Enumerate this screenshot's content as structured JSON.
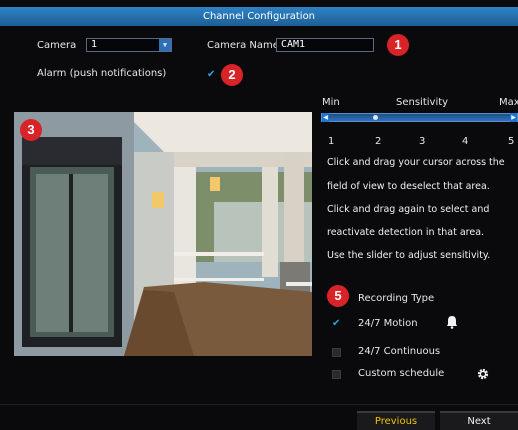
{
  "window": {
    "title": "Channel Configuration"
  },
  "camera": {
    "label": "Camera",
    "value": "1"
  },
  "camera_name": {
    "label": "Camera Name",
    "value": "CAM1"
  },
  "alarm": {
    "label": "Alarm (push notifications)",
    "checked": true
  },
  "callouts": [
    "1",
    "2",
    "3",
    "5"
  ],
  "sensitivity": {
    "min_label": "Min",
    "title": "Sensitivity",
    "max_label": "Max",
    "ticks": [
      "1",
      "2",
      "3",
      "4",
      "5"
    ],
    "level": 2
  },
  "instructions": [
    "Click and drag your cursor across the",
    "field of view to deselect that area.",
    "Click and drag again to select and",
    "reactivate detection in that area.",
    "Use the slider to adjust sensitivity."
  ],
  "recording": {
    "title": "Recording Type",
    "options": [
      {
        "label": "24/7 Motion",
        "checked": true,
        "icon": "bell-icon"
      },
      {
        "label": "24/7 Continuous",
        "checked": false
      },
      {
        "label": "Custom schedule",
        "checked": false,
        "icon": "gear-icon"
      }
    ]
  },
  "footer": {
    "previous_label": "Previous",
    "next_label": "Next"
  },
  "colors": {
    "accent": "#2d83c6",
    "callout": "#d82428",
    "previous_text": "#f2c200"
  }
}
